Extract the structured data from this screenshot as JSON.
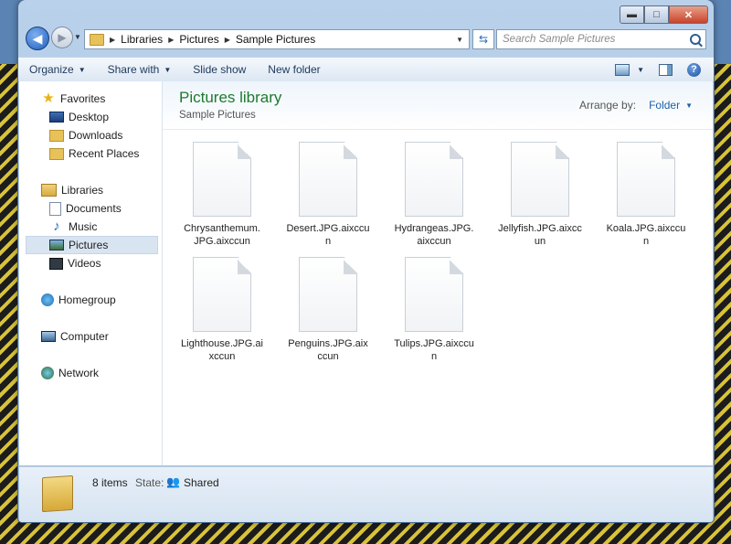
{
  "window": {
    "caption": {
      "minimize": "▬",
      "maximize": "□",
      "close": "✕"
    }
  },
  "nav": {
    "back_glyph": "◀",
    "forward_glyph": "▶",
    "address": [
      "Libraries",
      "Pictures",
      "Sample Pictures"
    ],
    "search_placeholder": "Search Sample Pictures"
  },
  "toolbar": {
    "organize": "Organize",
    "share_with": "Share with",
    "slide_show": "Slide show",
    "new_folder": "New folder",
    "help": "?"
  },
  "sidebar": {
    "favorites": "Favorites",
    "desktop": "Desktop",
    "downloads": "Downloads",
    "recent_places": "Recent Places",
    "libraries": "Libraries",
    "documents": "Documents",
    "music": "Music",
    "pictures": "Pictures",
    "videos": "Videos",
    "homegroup": "Homegroup",
    "computer": "Computer",
    "network": "Network"
  },
  "library": {
    "title": "Pictures library",
    "subtitle": "Sample Pictures",
    "arrange_label": "Arrange by:",
    "arrange_value": "Folder"
  },
  "files": [
    {
      "name": "Chrysanthemum.\nJPG.aixccun"
    },
    {
      "name": "Desert.JPG.aixccu\nn"
    },
    {
      "name": "Hydrangeas.JPG.\naixccun"
    },
    {
      "name": "Jellyfish.JPG.aixcc\nun"
    },
    {
      "name": "Koala.JPG.aixccu\nn"
    },
    {
      "name": "Lighthouse.JPG.ai\nxccun"
    },
    {
      "name": "Penguins.JPG.aix\nccun"
    },
    {
      "name": "Tulips.JPG.aixccu\nn"
    }
  ],
  "details": {
    "count": "8 items",
    "state_label": "State:",
    "state_value": "Shared"
  },
  "colors": {
    "title_green": "#1e7a2f",
    "link_blue": "#1e5fa8"
  }
}
